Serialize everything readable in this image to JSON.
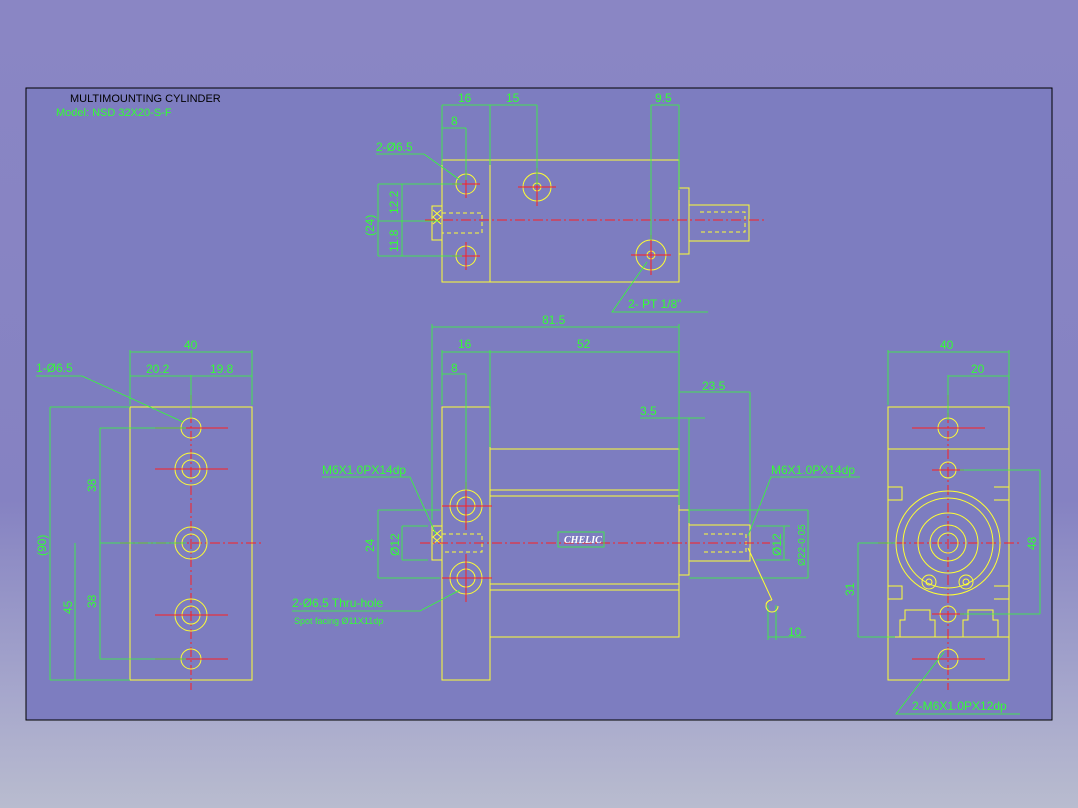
{
  "title": {
    "main": "MULTIMOUNTING CYLINDER",
    "model": "Model: NSD 32X20-S-F"
  },
  "brand": "CHELIC",
  "colors": {
    "background": "#8582c2",
    "frame_fill": "#7d7dc0",
    "outline": "#ffff33",
    "dimension": "#33ff33",
    "centerline": "#ff2020"
  },
  "top_view": {
    "dims": {
      "d16": "16",
      "d15": "15",
      "d8": "8",
      "d95": "9.5",
      "d122": "12.2",
      "d24": "(24)",
      "d118": "11.8"
    },
    "callouts": {
      "holes": "2-Ø6.5",
      "ports": "2- PT 1/8\""
    }
  },
  "left_view": {
    "dims": {
      "w40": "40",
      "w202": "20.2",
      "w198": "19.8",
      "h38a": "38",
      "h38b": "38",
      "h90": "(90)",
      "h45": "45"
    },
    "callouts": {
      "hole": "1-Ø6.5"
    }
  },
  "front_view": {
    "dims": {
      "l815": "81.5",
      "l16": "16",
      "l52": "52",
      "l8": "8",
      "l235": "23.5",
      "l35": "3.5",
      "d24": "24",
      "d12l": "Ø12",
      "d12r": "Ø12",
      "d22": "Ø22-0.05",
      "d10": "10"
    },
    "callouts": {
      "thread_left": "M6X1.0PX14dp",
      "thread_right": "M6X1.0PX14dp",
      "thru_hole": "2-Ø6.5 Thru-hole",
      "spot_facing": "Spot facing Ø11X11dp"
    }
  },
  "right_view": {
    "dims": {
      "w40": "40",
      "w20": "20",
      "h48": "48",
      "h31": "31"
    },
    "callouts": {
      "thread": "2-M6X1.0PX12dp"
    }
  }
}
